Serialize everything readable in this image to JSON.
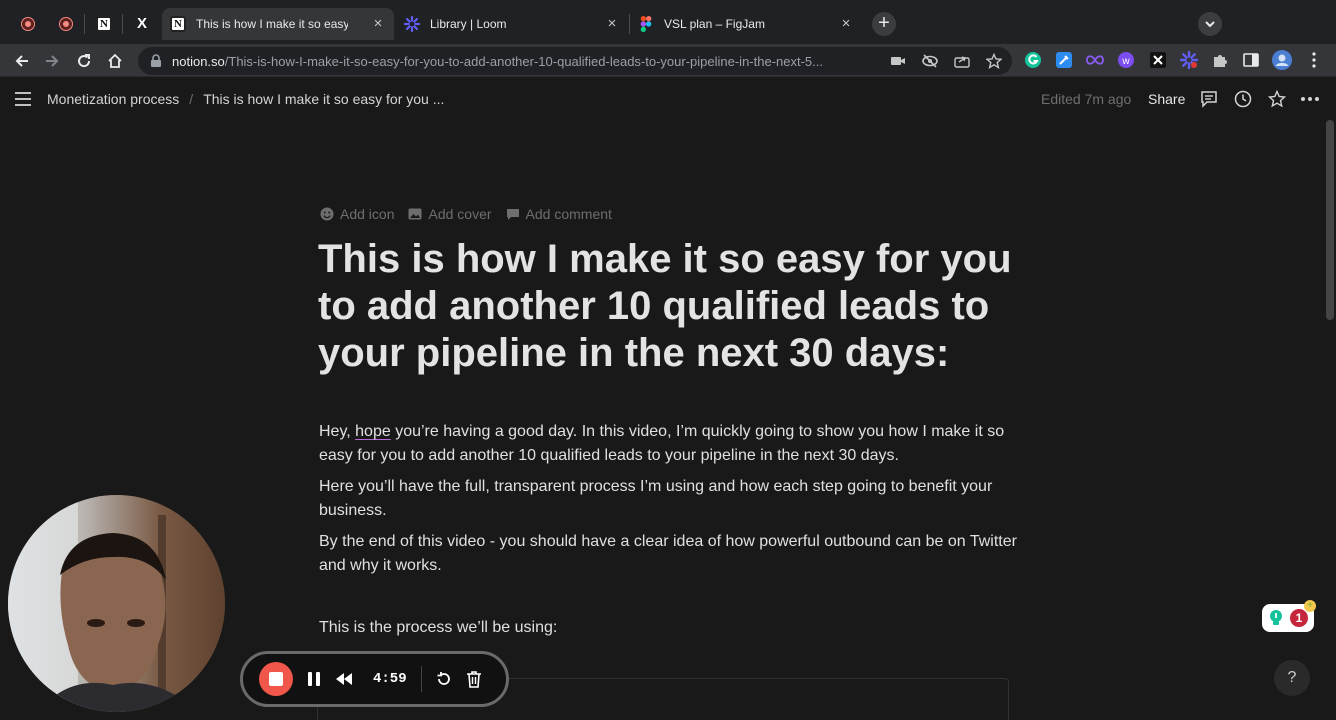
{
  "browser": {
    "tabs": [
      {
        "title": "This is how I make it so easy",
        "icon": "notion-icon",
        "active": true
      },
      {
        "title": "Library | Loom",
        "icon": "loom-icon",
        "active": false
      },
      {
        "title": "VSL plan – FigJam",
        "icon": "figma-icon",
        "active": false
      }
    ],
    "pinned_tabs": [
      "recording-icon",
      "recording-icon",
      "notion-icon",
      "x-icon"
    ],
    "new_tab_symbol": "+",
    "close_symbol": "×",
    "url_domain": "notion.so",
    "url_path": "/This-is-how-I-make-it-so-easy-for-you-to-add-another-10-qualified-leads-to-your-pipeline-in-the-next-5..."
  },
  "notion": {
    "breadcrumbs": [
      "Monetization process",
      "This is how I make it so easy for you ..."
    ],
    "breadcrumb_separator": "/",
    "edited": "Edited 7m ago",
    "share": "Share",
    "page_actions": [
      "Add icon",
      "Add cover",
      "Add comment"
    ],
    "title": "This is how I make it so easy for you to add another 10 qualified leads to your pipeline in the next 30 days:",
    "para1_before": "Hey, ",
    "para1_link": "hope",
    "para1_after": " you’re having a good day. In this video, I’m quickly going to show you how I make it so easy for you to add another 10 qualified leads to your pipeline in the next 30 days.",
    "para2": "Here you’ll have the full, transparent process I’m using and how each step going to benefit your business.",
    "para3": "By the end of this video - you should have a clear idea of how powerful outbound can be on Twitter and why it works.",
    "para4": "This is the process we’ll be using:"
  },
  "loom": {
    "timer": "4:59"
  },
  "widgets": {
    "grammarly_count": "1",
    "help": "?"
  },
  "colors": {
    "background": "#191919",
    "record_red": "#f0574a",
    "link_underline": "#b56ad8"
  }
}
